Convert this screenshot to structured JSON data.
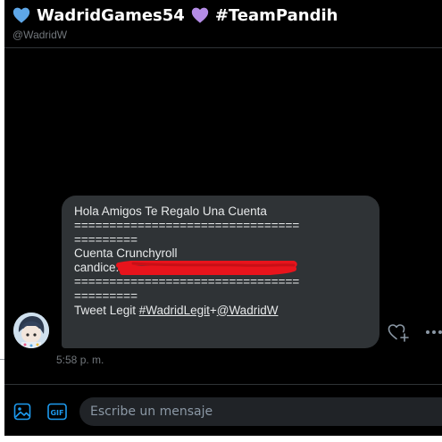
{
  "header": {
    "title_name": "WadridGames54",
    "title_hashtag": "#TeamPandih",
    "handle": "@WadridW",
    "heart_left_color": "#5ea7e8",
    "heart_right_color": "#b48ce6",
    "heart_left_icon": "blue-heart-icon",
    "heart_right_icon": "purple-heart-icon"
  },
  "message": {
    "line1": "Hola Amigos Te Regalo Una Cuenta",
    "separator1a": "================================",
    "separator1b": "=========",
    "line_service": "Cuenta Crunchyroll",
    "line_email_prefix": "candice.",
    "separator2a": "================================",
    "separator2b": "=========",
    "line_tweet_prefix": "Tweet Legit ",
    "hashtag": "#WadridLegit",
    "plus": "+",
    "mention": "@WadridW",
    "timestamp": "5:58 p. m.",
    "redaction_color": "#e8141c"
  },
  "actions": {
    "react_icon": "heart-plus-icon",
    "more_icon": "more-dots-icon"
  },
  "composer": {
    "image_icon": "image-icon",
    "gif_icon": "gif-icon",
    "placeholder": "Escribe un mensaje",
    "accent_color": "#1d9bf0"
  }
}
